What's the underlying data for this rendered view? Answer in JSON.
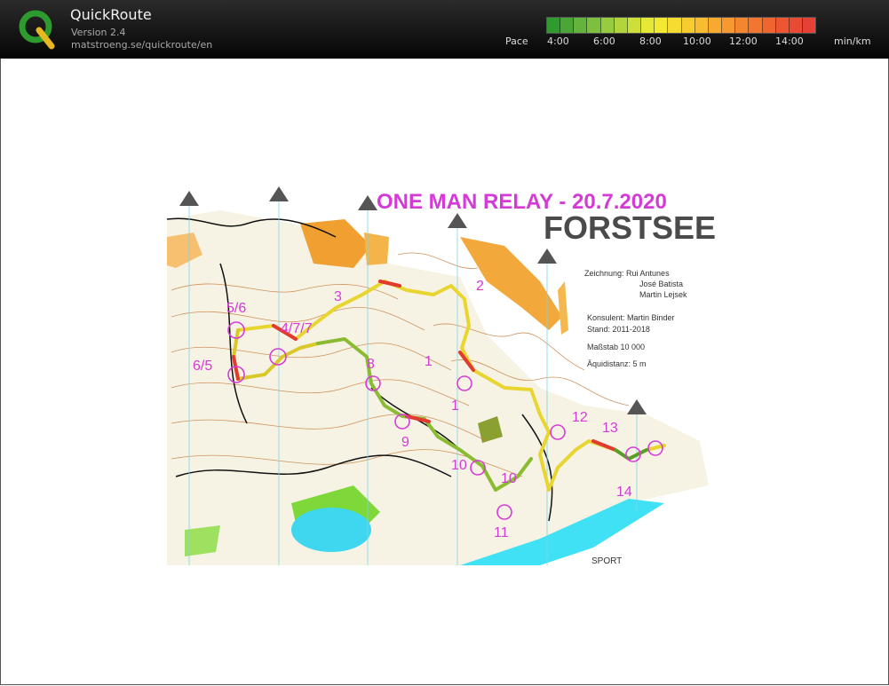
{
  "app": {
    "title": "QuickRoute",
    "version": "Version 2.4",
    "url": "matstroeng.se/quickroute/en"
  },
  "pace_scale": {
    "label": "Pace",
    "ticks": [
      "4:00",
      "6:00",
      "8:00",
      "10:00",
      "12:00",
      "14:00"
    ],
    "unit": "min/km",
    "colors": [
      "#2f9a2e",
      "#4aa636",
      "#63b33c",
      "#7dbf3f",
      "#97cb40",
      "#b2d53e",
      "#cfdf3a",
      "#e6e836",
      "#f2ea32",
      "#f6dc30",
      "#f8cc2f",
      "#f9bb2f",
      "#f8aa30",
      "#f79830",
      "#f58630",
      "#f27530",
      "#ef6530",
      "#ec5632",
      "#e94a34",
      "#e64137"
    ]
  },
  "map": {
    "title": "ONE MAN RELAY - 20.7.2020",
    "location": "FORSTSEE",
    "credits": [
      "Zeichnung: Rui Antunes",
      "José Batista",
      "Martin Lejsek",
      "Konsulent: Martin Binder",
      "Stand: 2011-2018",
      "Maßstab 10 000",
      "Äquidistanz: 5 m"
    ],
    "control_labels": [
      "5/6",
      "6/5",
      "3",
      "4/7/7",
      "8",
      "2",
      "1",
      "1",
      "9",
      "10",
      "10",
      "11",
      "12",
      "13",
      "14"
    ],
    "logo_text": "SPORT"
  }
}
